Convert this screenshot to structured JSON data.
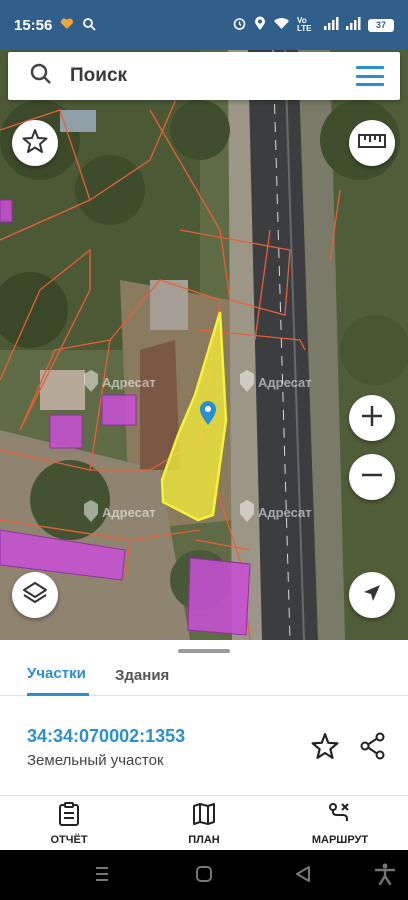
{
  "status_bar": {
    "time": "15:56",
    "network_label": "Vo LTE",
    "battery": "37"
  },
  "search": {
    "placeholder": "Поиск"
  },
  "map": {
    "watermark": "Адресат"
  },
  "sheet": {
    "tabs": [
      {
        "label": "Участки",
        "active": true
      },
      {
        "label": "Здания",
        "active": false
      }
    ],
    "parcel": {
      "number": "34:34:070002:1353",
      "type": "Земельный участок"
    }
  },
  "bottom_nav": [
    {
      "label": "ОТЧЁТ",
      "icon": "report-icon"
    },
    {
      "label": "ПЛАН",
      "icon": "map-plan-icon"
    },
    {
      "label": "МАРШРУТ",
      "icon": "route-icon"
    }
  ],
  "colors": {
    "status_bar": "#2f5f8a",
    "accent": "#2a8fd0",
    "parcel_fill": "#f5f23a",
    "building_fill": "#c94fd6",
    "boundary": "#e8603a"
  }
}
